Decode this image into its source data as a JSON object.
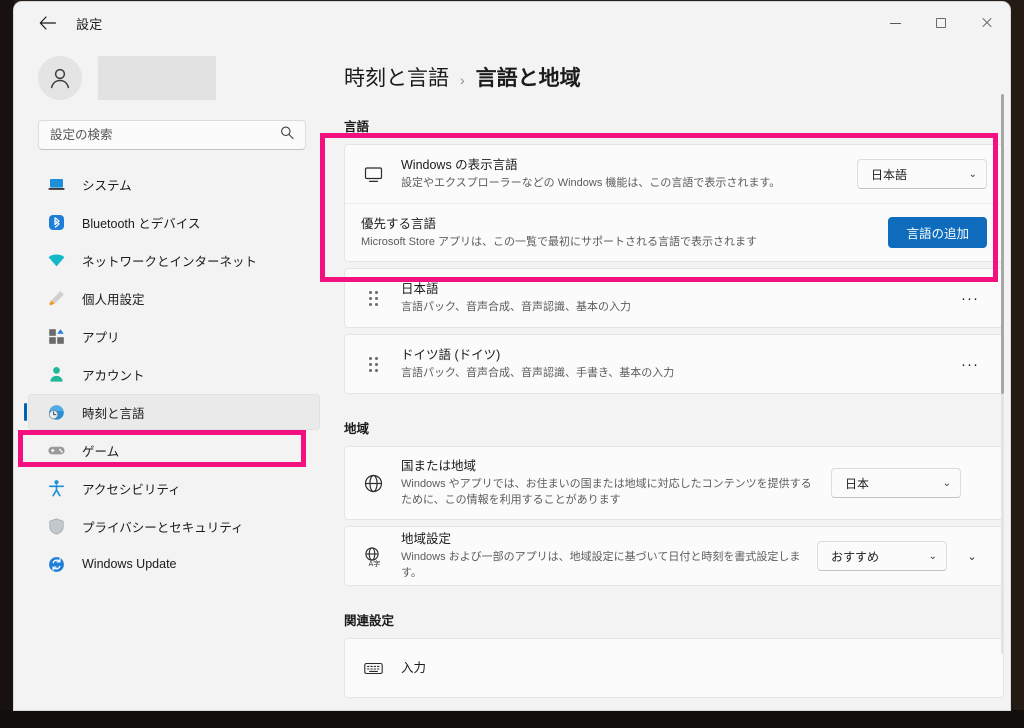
{
  "window": {
    "app_title": "設定",
    "back_icon": "back-arrow-icon",
    "minimize_label": "最小化",
    "maximize_label": "最大化",
    "close_label": "閉じる"
  },
  "sidebar": {
    "account_name_redacted": "",
    "search": {
      "placeholder": "設定の検索",
      "value": "",
      "icon": "search-icon"
    },
    "items": [
      {
        "label": "システム",
        "icon": "laptop-icon",
        "selected": false
      },
      {
        "label": "Bluetooth とデバイス",
        "icon": "bluetooth-icon",
        "selected": false
      },
      {
        "label": "ネットワークとインターネット",
        "icon": "wifi-icon",
        "selected": false
      },
      {
        "label": "個人用設定",
        "icon": "paintbrush-icon",
        "selected": false
      },
      {
        "label": "アプリ",
        "icon": "apps-icon",
        "selected": false
      },
      {
        "label": "アカウント",
        "icon": "account-icon",
        "selected": false
      },
      {
        "label": "時刻と言語",
        "icon": "clock-globe-icon",
        "selected": true
      },
      {
        "label": "ゲーム",
        "icon": "gamepad-icon",
        "selected": false
      },
      {
        "label": "アクセシビリティ",
        "icon": "accessibility-icon",
        "selected": false
      },
      {
        "label": "プライバシーとセキュリティ",
        "icon": "shield-icon",
        "selected": false
      },
      {
        "label": "Windows Update",
        "icon": "update-icon",
        "selected": false
      }
    ]
  },
  "content": {
    "breadcrumb": {
      "parent": "時刻と言語",
      "separator": "›",
      "current": "言語と地域"
    },
    "sections": {
      "language": {
        "heading": "言語",
        "display_language": {
          "icon": "monitor-icon",
          "title": "Windows の表示言語",
          "subtitle": "設定やエクスプローラーなどの Windows 機能は、この言語で表示されます。",
          "value": "日本語",
          "chevron": "⌄"
        },
        "preferred_languages": {
          "title": "優先する言語",
          "subtitle": "Microsoft Store アプリは、この一覧で最初にサポートされる言語で表示されます",
          "add_button": "言語の追加"
        },
        "list": [
          {
            "name": "日本語",
            "features": "言語パック、音声合成、音声認識、基本の入力",
            "more": "···"
          },
          {
            "name": "ドイツ語 (ドイツ)",
            "features": "言語パック、音声合成、音声認識、手書き、基本の入力",
            "more": "···"
          }
        ]
      },
      "region": {
        "heading": "地域",
        "country": {
          "icon": "globe-icon",
          "title": "国または地域",
          "subtitle": "Windows やアプリでは、お住まいの国または地域に対応したコンテンツを提供するために、この情報を利用することがあります",
          "value": "日本",
          "chevron": "⌄"
        },
        "regional_format": {
          "icon": "globe-text-icon",
          "title": "地域設定",
          "subtitle": "Windows および一部のアプリは、地域設定に基づいて日付と時刻を書式設定します。",
          "value": "おすすめ",
          "chevron": "⌄",
          "expand_chevron": "⌄"
        }
      },
      "related": {
        "heading": "関連設定",
        "input": {
          "icon": "keyboard-icon",
          "title": "入力"
        }
      }
    }
  },
  "annotations": {
    "highlight_color": "#f4117f",
    "boxes": [
      {
        "name": "language-card-highlight",
        "target": "言語 card"
      },
      {
        "name": "nav-item-highlight",
        "target": "時刻と言語"
      }
    ]
  }
}
